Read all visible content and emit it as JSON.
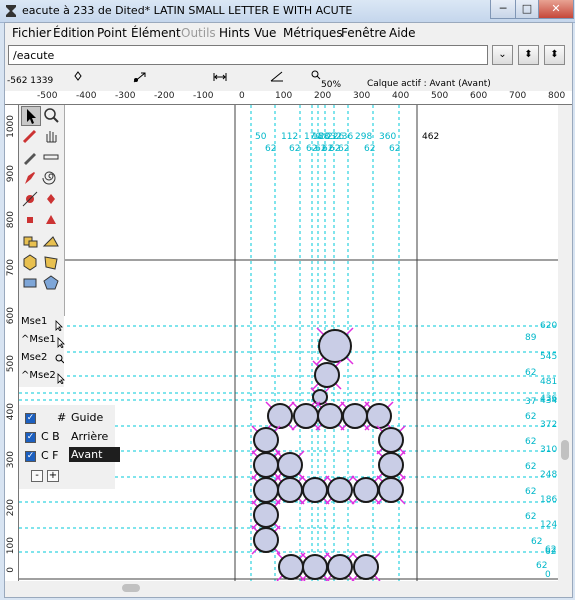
{
  "window": {
    "title": "eacute à 233 de Dited* LATIN SMALL LETTER E WITH ACUTE",
    "minimize": "─",
    "maximize": "□",
    "close": "✕"
  },
  "menu": [
    "Fichier",
    "Édition",
    "Point",
    "Élément",
    "Outils",
    "Hints",
    "Vue",
    "Métriques",
    "Fenêtre",
    "Aide"
  ],
  "menu_disabled": "Outils",
  "glyph_field": {
    "value": "/eacute"
  },
  "nav_buttons": [
    "⌄",
    "⬍",
    "⬍"
  ],
  "info": {
    "coords": "-562 1339",
    "zoom": "50%",
    "active_layer": "Calque actif : Avant (Avant)"
  },
  "hruler_ticks": [
    "-500",
    "-400",
    "-300",
    "-200",
    "-100",
    "0",
    "100",
    "200",
    "300",
    "400",
    "500",
    "600",
    "700",
    "800"
  ],
  "vruler_ticks": [
    "1000",
    "900",
    "800",
    "700",
    "600",
    "500",
    "400",
    "300",
    "200",
    "100",
    "0"
  ],
  "modifiers": [
    "Mse1",
    "^Mse1",
    "Mse2",
    "^Mse2"
  ],
  "layers": [
    {
      "prefix": "#",
      "label": "Guide"
    },
    {
      "prefix": "C B",
      "label": "Arrière"
    },
    {
      "prefix": "C F",
      "label": "Avant"
    }
  ],
  "layer_controls": [
    "-",
    "+"
  ],
  "canvas": {
    "width_value": "462",
    "x_top_labels": [
      "50",
      "112",
      "170",
      "188",
      "203",
      "226",
      "236",
      "298",
      "360"
    ],
    "x_second_labels": [
      "62",
      "62",
      "62",
      "62",
      "62",
      "62",
      "62",
      "62",
      "62"
    ],
    "y_right_labels": [
      "620",
      "545",
      "481",
      "436",
      "434",
      "372",
      "310",
      "248",
      "186",
      "124",
      "62",
      "0"
    ],
    "y_left_labels": [
      "89",
      "62",
      "37",
      "62",
      "62",
      "62",
      "62",
      "62",
      "62",
      "62",
      "62",
      "0"
    ]
  },
  "colors": {
    "guide": "#00c8d8",
    "point_fill": "#c9cde6",
    "point_stroke": "#1a1a1a",
    "control": "#e030e0",
    "selected_layer_bg": "#1e1e1e"
  }
}
